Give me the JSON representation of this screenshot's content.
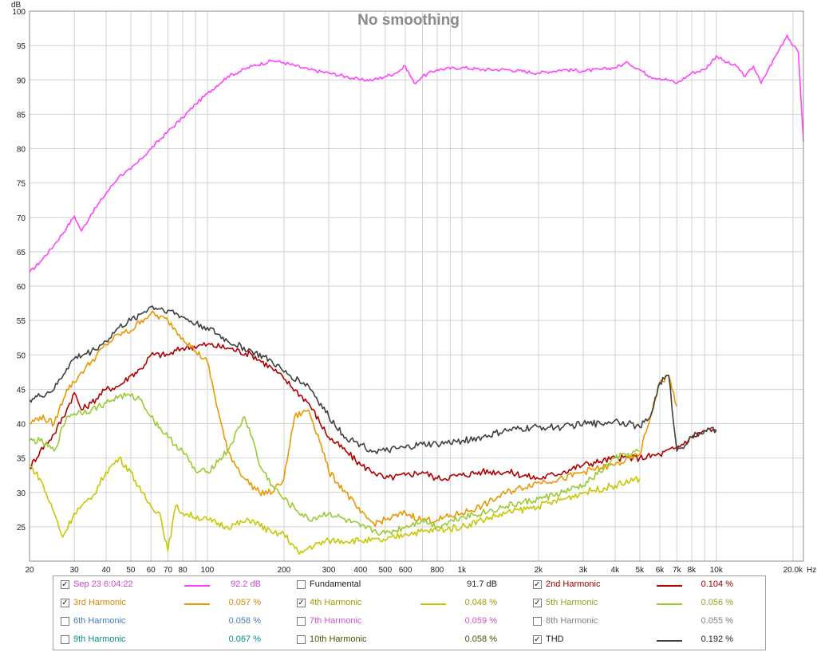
{
  "chart_data": {
    "type": "line",
    "title": "No smoothing",
    "ylabel": "dB",
    "xunit": "Hz",
    "xscale": "log",
    "xlim": [
      20,
      22000
    ],
    "ylim": [
      20,
      100
    ],
    "grid": true,
    "xticks": [
      {
        "v": 20,
        "label": "20"
      },
      {
        "v": 30,
        "label": "30"
      },
      {
        "v": 40,
        "label": "40"
      },
      {
        "v": 50,
        "label": "50"
      },
      {
        "v": 60,
        "label": "60"
      },
      {
        "v": 70,
        "label": "70"
      },
      {
        "v": 80,
        "label": "80"
      },
      {
        "v": 100,
        "label": "100"
      },
      {
        "v": 200,
        "label": "200"
      },
      {
        "v": 300,
        "label": "300"
      },
      {
        "v": 400,
        "label": "400"
      },
      {
        "v": 500,
        "label": "500"
      },
      {
        "v": 600,
        "label": "600"
      },
      {
        "v": 800,
        "label": "800"
      },
      {
        "v": 1000,
        "label": "1k"
      },
      {
        "v": 2000,
        "label": "2k"
      },
      {
        "v": 3000,
        "label": "3k"
      },
      {
        "v": 4000,
        "label": "4k"
      },
      {
        "v": 5000,
        "label": "5k"
      },
      {
        "v": 6000,
        "label": "6k"
      },
      {
        "v": 7000,
        "label": "7k"
      },
      {
        "v": 8000,
        "label": "8k"
      },
      {
        "v": 10000,
        "label": "10k"
      },
      {
        "v": 20000,
        "label": "20.0k"
      }
    ],
    "yticks": [
      25,
      30,
      35,
      40,
      45,
      50,
      55,
      60,
      65,
      70,
      75,
      80,
      85,
      90,
      95,
      100
    ],
    "series": [
      {
        "key": "fund",
        "color": "#ff44ff",
        "points": [
          [
            20,
            62
          ],
          [
            22,
            63.5
          ],
          [
            25,
            66
          ],
          [
            28,
            68.5
          ],
          [
            30,
            70.2
          ],
          [
            32,
            68
          ],
          [
            35,
            70.5
          ],
          [
            40,
            73.5
          ],
          [
            45,
            76
          ],
          [
            50,
            77
          ],
          [
            55,
            78.5
          ],
          [
            60,
            80
          ],
          [
            70,
            82.5
          ],
          [
            80,
            84.5
          ],
          [
            90,
            86.5
          ],
          [
            100,
            88
          ],
          [
            120,
            90.5
          ],
          [
            150,
            92
          ],
          [
            180,
            92.8
          ],
          [
            200,
            92.5
          ],
          [
            250,
            91.5
          ],
          [
            300,
            91
          ],
          [
            350,
            90.5
          ],
          [
            400,
            90
          ],
          [
            450,
            90
          ],
          [
            500,
            90.5
          ],
          [
            550,
            91
          ],
          [
            600,
            92
          ],
          [
            650,
            89.5
          ],
          [
            700,
            90.5
          ],
          [
            800,
            91.5
          ],
          [
            1000,
            91.8
          ],
          [
            1200,
            91.5
          ],
          [
            1500,
            91.5
          ],
          [
            2000,
            91
          ],
          [
            2500,
            91.5
          ],
          [
            3000,
            91.3
          ],
          [
            3500,
            91.5
          ],
          [
            4000,
            91.8
          ],
          [
            4500,
            92.5
          ],
          [
            5000,
            91.5
          ],
          [
            5500,
            90.5
          ],
          [
            6000,
            90.2
          ],
          [
            6500,
            90
          ],
          [
            7000,
            89.5
          ],
          [
            8000,
            91
          ],
          [
            9000,
            91.5
          ],
          [
            10000,
            93.5
          ],
          [
            11000,
            92.5
          ],
          [
            12000,
            92
          ],
          [
            13000,
            90.5
          ],
          [
            14000,
            92
          ],
          [
            15000,
            89.5
          ],
          [
            16000,
            91.5
          ],
          [
            18000,
            95
          ],
          [
            19000,
            96.5
          ],
          [
            20000,
            95
          ],
          [
            21000,
            94
          ],
          [
            22000,
            81
          ]
        ]
      },
      {
        "key": "h2",
        "color": "#b00000",
        "points": [
          [
            20,
            33.5
          ],
          [
            22,
            36
          ],
          [
            25,
            38.5
          ],
          [
            28,
            42
          ],
          [
            30,
            44.5
          ],
          [
            32,
            42
          ],
          [
            35,
            43
          ],
          [
            40,
            45
          ],
          [
            45,
            45.5
          ],
          [
            50,
            47
          ],
          [
            55,
            48
          ],
          [
            60,
            50
          ],
          [
            70,
            50
          ],
          [
            80,
            51
          ],
          [
            100,
            51.5
          ],
          [
            120,
            51
          ],
          [
            150,
            50
          ],
          [
            180,
            48
          ],
          [
            200,
            46.5
          ],
          [
            250,
            43
          ],
          [
            300,
            38
          ],
          [
            350,
            36
          ],
          [
            400,
            34
          ],
          [
            450,
            33
          ],
          [
            500,
            32
          ],
          [
            600,
            32.5
          ],
          [
            700,
            33
          ],
          [
            800,
            32
          ],
          [
            1000,
            32.5
          ],
          [
            1200,
            33
          ],
          [
            1500,
            33
          ],
          [
            2000,
            32
          ],
          [
            2500,
            33
          ],
          [
            3000,
            34
          ],
          [
            3500,
            34.5
          ],
          [
            4000,
            35
          ],
          [
            5000,
            35
          ],
          [
            6000,
            35.5
          ],
          [
            7000,
            36.5
          ],
          [
            8000,
            38
          ],
          [
            9000,
            39
          ],
          [
            10000,
            39
          ]
        ]
      },
      {
        "key": "h3",
        "color": "#e89800",
        "points": [
          [
            20,
            40
          ],
          [
            22,
            41
          ],
          [
            25,
            40
          ],
          [
            28,
            45
          ],
          [
            30,
            46
          ],
          [
            32,
            47.5
          ],
          [
            35,
            49
          ],
          [
            40,
            51.5
          ],
          [
            45,
            53
          ],
          [
            50,
            53.5
          ],
          [
            55,
            55
          ],
          [
            60,
            56
          ],
          [
            70,
            55
          ],
          [
            80,
            52.5
          ],
          [
            90,
            50.5
          ],
          [
            100,
            49
          ],
          [
            110,
            42
          ],
          [
            120,
            36
          ],
          [
            140,
            32
          ],
          [
            160,
            30
          ],
          [
            180,
            30
          ],
          [
            200,
            32
          ],
          [
            220,
            41
          ],
          [
            250,
            42
          ],
          [
            280,
            37
          ],
          [
            300,
            33
          ],
          [
            350,
            30
          ],
          [
            400,
            27
          ],
          [
            450,
            25.5
          ],
          [
            500,
            26
          ],
          [
            600,
            27
          ],
          [
            700,
            26
          ],
          [
            800,
            26
          ],
          [
            1000,
            27
          ],
          [
            1200,
            28
          ],
          [
            1500,
            30
          ],
          [
            2000,
            31.5
          ],
          [
            2500,
            32
          ],
          [
            3000,
            33
          ],
          [
            4000,
            34
          ],
          [
            5000,
            35.5
          ],
          [
            6000,
            46
          ],
          [
            6500,
            47
          ],
          [
            7000,
            42.5
          ]
        ]
      },
      {
        "key": "h4",
        "color": "#c8c800",
        "points": [
          [
            20,
            34
          ],
          [
            22,
            32
          ],
          [
            25,
            27
          ],
          [
            27,
            23.5
          ],
          [
            30,
            27
          ],
          [
            32,
            28
          ],
          [
            35,
            29
          ],
          [
            40,
            33
          ],
          [
            45,
            35
          ],
          [
            50,
            33
          ],
          [
            55,
            30
          ],
          [
            60,
            28
          ],
          [
            65,
            27
          ],
          [
            70,
            21.5
          ],
          [
            75,
            28
          ],
          [
            80,
            27
          ],
          [
            100,
            26
          ],
          [
            120,
            25
          ],
          [
            150,
            26
          ],
          [
            180,
            24
          ],
          [
            200,
            24
          ],
          [
            230,
            21
          ],
          [
            250,
            22
          ],
          [
            300,
            23
          ],
          [
            400,
            23
          ],
          [
            500,
            23
          ],
          [
            600,
            24
          ],
          [
            800,
            24.5
          ],
          [
            1000,
            25
          ],
          [
            1200,
            26
          ],
          [
            1500,
            27
          ],
          [
            2000,
            28
          ],
          [
            2500,
            29
          ],
          [
            3000,
            30
          ],
          [
            4000,
            31
          ],
          [
            5000,
            32
          ]
        ]
      },
      {
        "key": "h5",
        "color": "#99cc33",
        "points": [
          [
            20,
            37.5
          ],
          [
            22,
            37.5
          ],
          [
            25,
            36
          ],
          [
            28,
            41
          ],
          [
            30,
            41.5
          ],
          [
            35,
            42
          ],
          [
            40,
            43
          ],
          [
            45,
            44
          ],
          [
            50,
            44
          ],
          [
            55,
            43.5
          ],
          [
            60,
            41
          ],
          [
            70,
            38
          ],
          [
            80,
            36
          ],
          [
            90,
            33
          ],
          [
            100,
            33
          ],
          [
            120,
            36
          ],
          [
            140,
            41
          ],
          [
            150,
            38
          ],
          [
            160,
            34
          ],
          [
            180,
            31
          ],
          [
            200,
            29
          ],
          [
            250,
            26
          ],
          [
            300,
            27
          ],
          [
            400,
            25
          ],
          [
            500,
            24
          ],
          [
            600,
            25
          ],
          [
            700,
            26
          ],
          [
            800,
            25
          ],
          [
            1000,
            26.5
          ],
          [
            1200,
            27
          ],
          [
            1500,
            28
          ],
          [
            2000,
            29
          ],
          [
            2500,
            30
          ],
          [
            3000,
            31
          ],
          [
            3500,
            33
          ],
          [
            4000,
            35
          ],
          [
            5000,
            36
          ]
        ]
      },
      {
        "key": "thd",
        "color": "#404040",
        "points": [
          [
            20,
            43.5
          ],
          [
            22,
            44
          ],
          [
            25,
            45
          ],
          [
            28,
            48
          ],
          [
            30,
            49.5
          ],
          [
            35,
            50.5
          ],
          [
            40,
            52
          ],
          [
            45,
            54
          ],
          [
            50,
            55
          ],
          [
            55,
            56
          ],
          [
            60,
            57
          ],
          [
            70,
            56.5
          ],
          [
            80,
            55.5
          ],
          [
            90,
            54.5
          ],
          [
            100,
            54
          ],
          [
            120,
            52
          ],
          [
            150,
            50.5
          ],
          [
            180,
            49
          ],
          [
            200,
            47.5
          ],
          [
            250,
            45.5
          ],
          [
            300,
            41
          ],
          [
            350,
            38
          ],
          [
            400,
            37
          ],
          [
            450,
            36
          ],
          [
            500,
            36
          ],
          [
            600,
            36.5
          ],
          [
            700,
            37
          ],
          [
            800,
            37
          ],
          [
            1000,
            37.5
          ],
          [
            1200,
            38
          ],
          [
            1500,
            39
          ],
          [
            2000,
            39.5
          ],
          [
            2500,
            39.5
          ],
          [
            3000,
            40
          ],
          [
            3500,
            40
          ],
          [
            4000,
            40.5
          ],
          [
            4500,
            40
          ],
          [
            5000,
            39.5
          ],
          [
            5500,
            41
          ],
          [
            6000,
            46
          ],
          [
            6500,
            47
          ],
          [
            7000,
            36
          ],
          [
            8000,
            38
          ],
          [
            9000,
            39
          ],
          [
            10000,
            39
          ]
        ]
      }
    ]
  },
  "legend": [
    [
      {
        "name": "Sep 23 6:04:22",
        "value": "92.2 dB",
        "checked": true,
        "color": "#cc44cc",
        "line": "#ff44ff"
      },
      {
        "name": "Fundamental",
        "value": "91.7 dB",
        "checked": false,
        "color": "#222222",
        "line": ""
      },
      {
        "name": "2nd Harmonic",
        "value": "0.104 %",
        "checked": true,
        "color": "#a00000",
        "line": "#b00000"
      }
    ],
    [
      {
        "name": "3rd Harmonic",
        "value": "0.057 %",
        "checked": true,
        "color": "#d68a00",
        "line": "#e89800"
      },
      {
        "name": "4th Harmonic",
        "value": "0.048 %",
        "checked": true,
        "color": "#a0a000",
        "line": "#c8c800"
      },
      {
        "name": "5th Harmonic",
        "value": "0.056 %",
        "checked": true,
        "color": "#88aa22",
        "line": "#99cc33"
      }
    ],
    [
      {
        "name": "6th Harmonic",
        "value": "0.058 %",
        "checked": false,
        "color": "#4a7ab8",
        "line": ""
      },
      {
        "name": "7th Harmonic",
        "value": "0.059 %",
        "checked": false,
        "color": "#cc55cc",
        "line": ""
      },
      {
        "name": "8th Harmonic",
        "value": "0.055 %",
        "checked": false,
        "color": "#808080",
        "line": ""
      }
    ],
    [
      {
        "name": "9th Harmonic",
        "value": "0.067 %",
        "checked": false,
        "color": "#008c8c",
        "line": ""
      },
      {
        "name": "10th Harmonic",
        "value": "0.058 %",
        "checked": false,
        "color": "#4f5000",
        "line": ""
      },
      {
        "name": "THD",
        "value": "0.192 %",
        "checked": true,
        "color": "#222222",
        "line": "#404040"
      }
    ]
  ]
}
